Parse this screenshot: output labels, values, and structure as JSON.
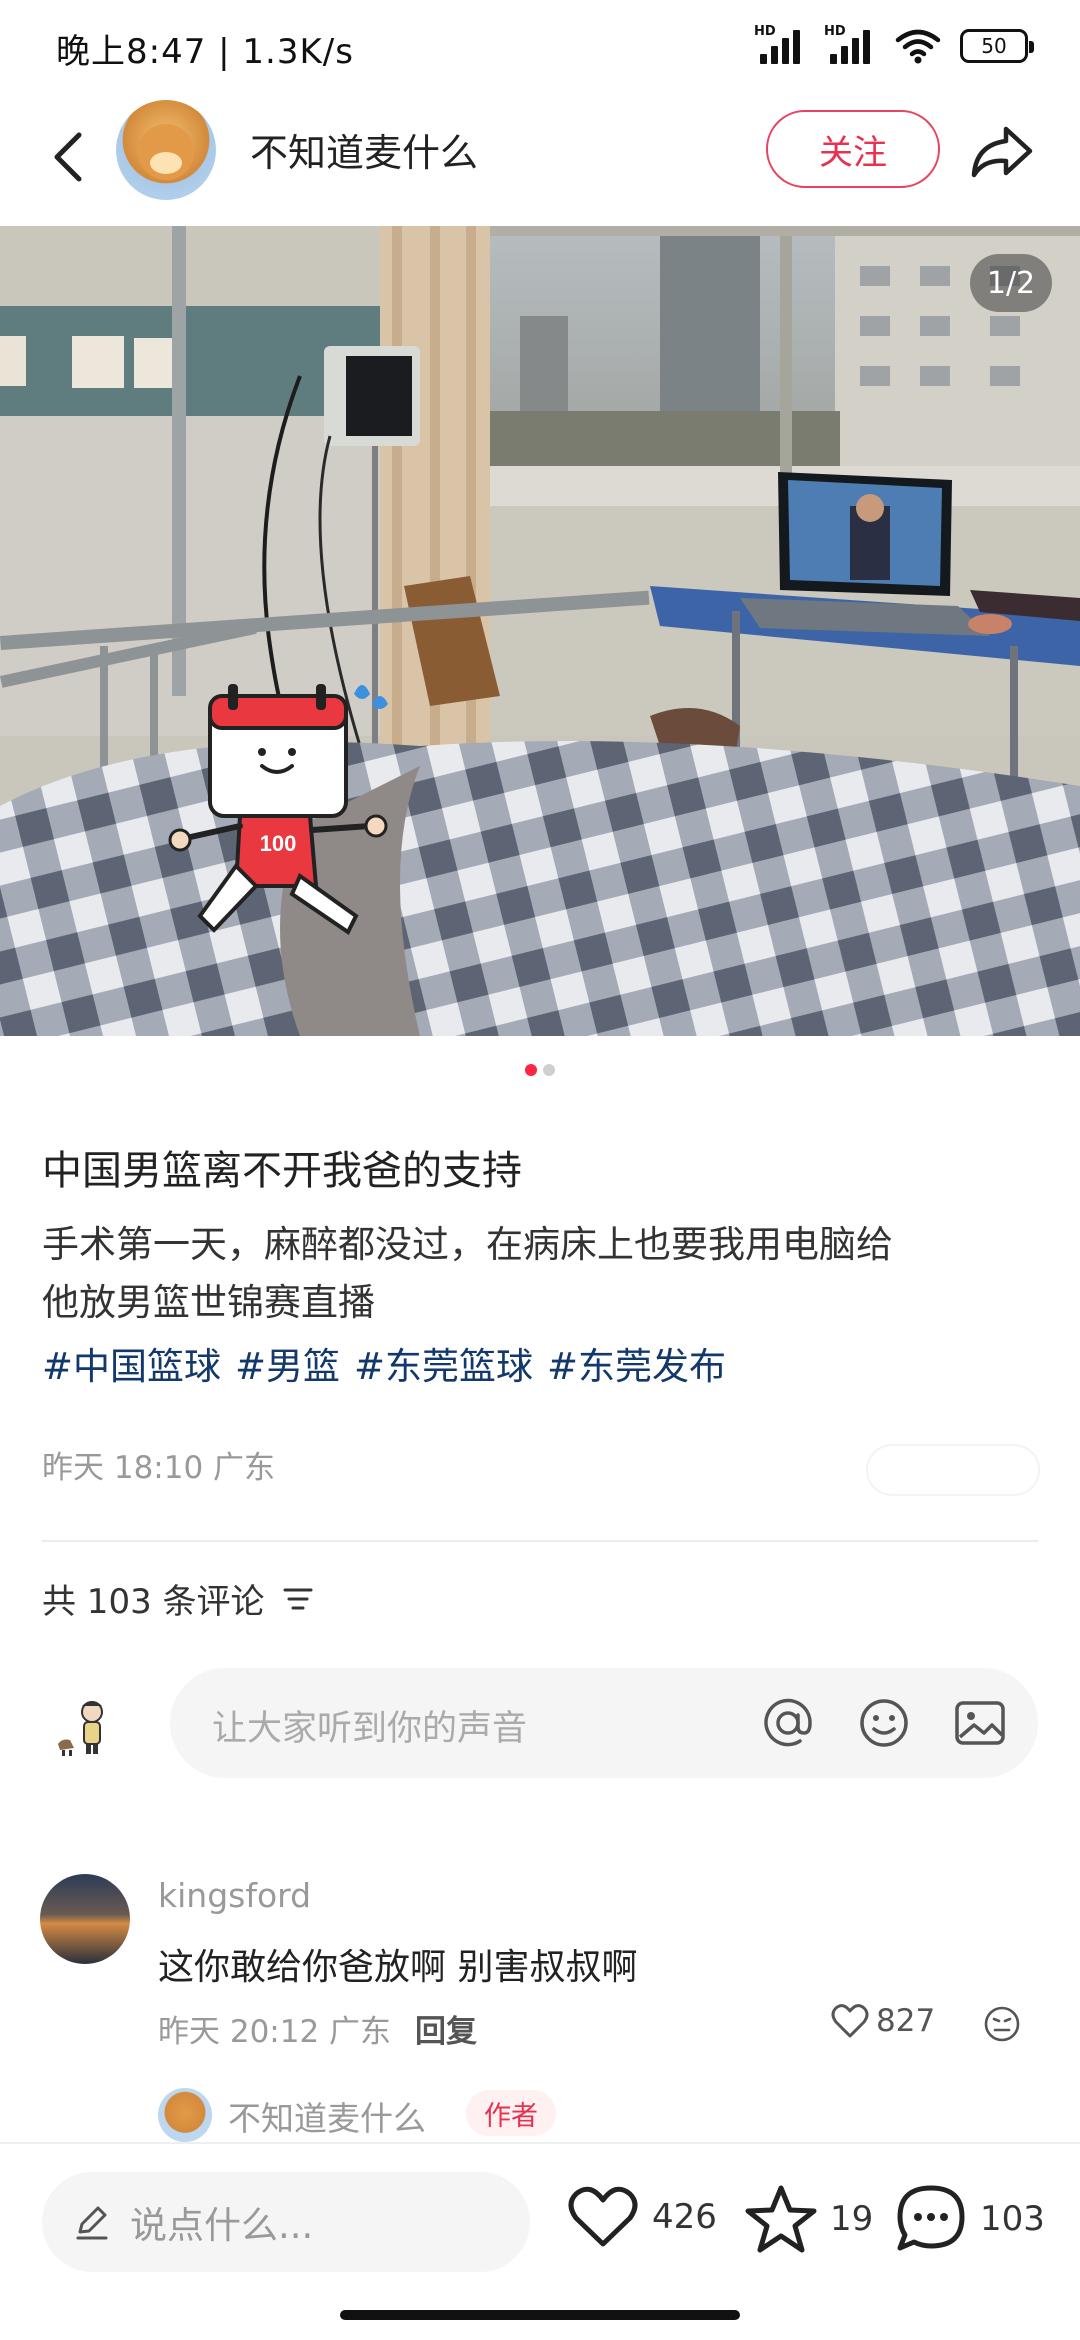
{
  "status_bar": {
    "time": "晚上8:47 | 1.3K/s",
    "signal_label_1": "HD",
    "signal_label_2": "HD",
    "battery": "50"
  },
  "header": {
    "author_name": "不知道麦什么",
    "follow_label": "关注"
  },
  "photo": {
    "counter": "1/2",
    "sticker_bib": "100",
    "pages": 2,
    "current_page": 1
  },
  "post": {
    "title": "中国男篮离不开我爸的支持",
    "body_line1": "手术第一天，麻醉都没过，在病床上也要我用电脑给",
    "body_line2": "他放男篮世锦赛直播",
    "tags": [
      "#中国篮球",
      "#男篮",
      "#东莞篮球",
      "#东莞发布"
    ],
    "meta": "昨天 18:10 广东"
  },
  "comments": {
    "count_label": "共 103 条评论",
    "input_placeholder": "让大家听到你的声音",
    "items": [
      {
        "user": "kingsford",
        "text": "这你敢给你爸放啊 别害叔叔啊",
        "time_location": "昨天 20:12 广东",
        "reply_label": "回复",
        "likes": "827"
      }
    ],
    "reply_preview": {
      "user": "不知道麦什么",
      "badge": "作者"
    }
  },
  "bottom_bar": {
    "input_placeholder": "说点什么...",
    "likes": "426",
    "stars": "19",
    "comments": "103"
  },
  "colors": {
    "accent": "#ff2442",
    "tag_link": "#13386c",
    "muted_text": "#999999"
  },
  "icons": [
    "back-icon",
    "share-icon",
    "filter-icon",
    "at-icon",
    "emoji-icon",
    "image-icon",
    "heart-icon",
    "star-icon",
    "comment-icon",
    "pencil-icon"
  ]
}
